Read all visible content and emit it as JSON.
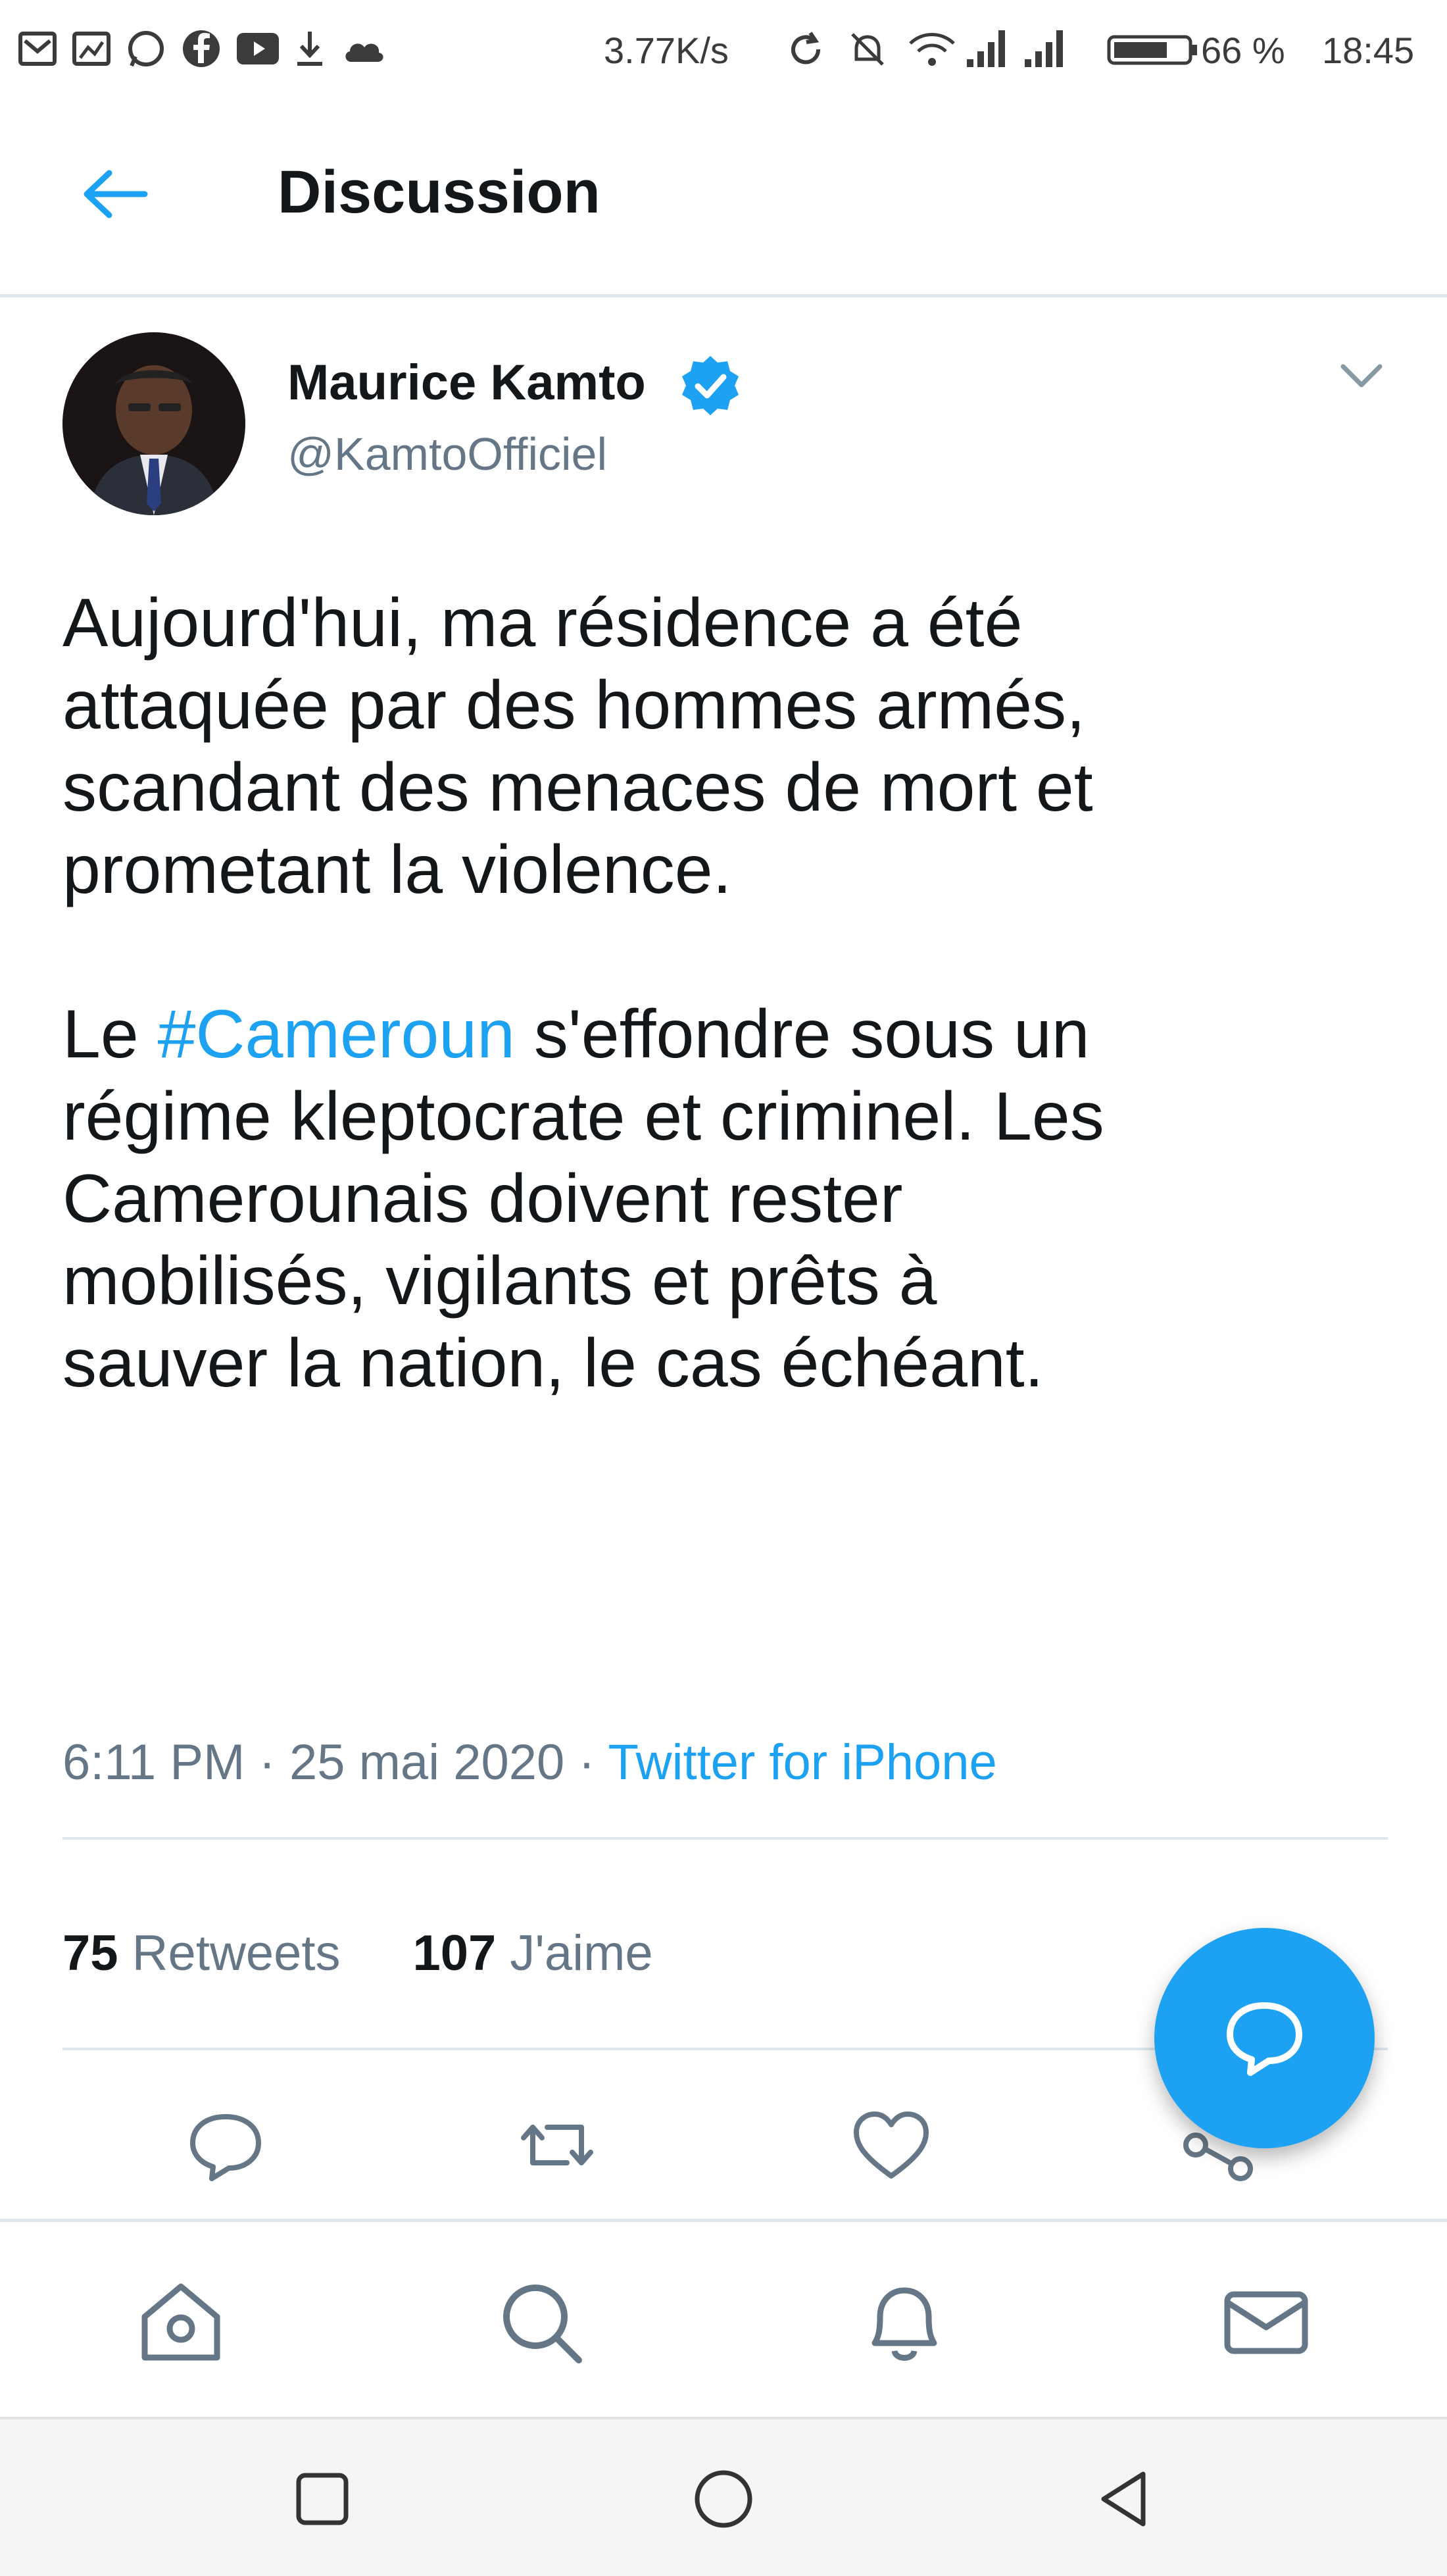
{
  "status_bar": {
    "speed": "3.77K/s",
    "battery": "66 %",
    "time": "18:45"
  },
  "header": {
    "title": "Discussion",
    "back_icon": "arrow-left-icon"
  },
  "tweet": {
    "author_name": "Maurice Kamto",
    "handle": "@KamtoOfficiel",
    "text_p1": "Aujourd'hui, ma résidence a été\nattaquée par des hommes armés,\nscandant des menaces de mort et\nprometant la violence.",
    "text_p2_before": "Le ",
    "hashtag": "#Cameroun",
    "text_p2_after": " s'effondre sous un\nrégime kleptocrate et criminel. Les\nCamerounais doivent rester\nmobilisés, vigilants et prêts à\nsauver la nation, le cas échéant.",
    "time": "6:11 PM",
    "date": "25 mai 2020",
    "source": "Twitter for iPhone",
    "separator": "·",
    "retweets_count": "75",
    "retweets_label": "Retweets",
    "likes_count": "107",
    "likes_label": "J'aime"
  },
  "actions": [
    "reply-icon",
    "retweet-icon",
    "like-icon",
    "share-icon"
  ],
  "bottom_nav": [
    "home-icon",
    "search-icon",
    "notifications-icon",
    "messages-icon"
  ],
  "colors": {
    "accent": "#1da1f2",
    "secondary_text": "#657786",
    "divider": "#e1e8ed"
  }
}
